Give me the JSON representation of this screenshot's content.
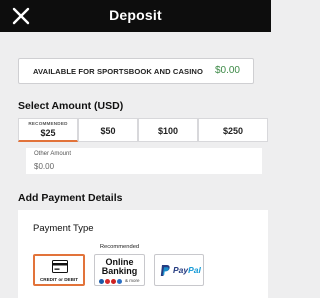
{
  "header": {
    "title": "Deposit",
    "close_icon": "close-icon"
  },
  "balance": {
    "label": "AVAILABLE FOR SPORTSBOOK AND CASINO",
    "value": "$0.00",
    "value_color": "#3d8a47"
  },
  "select_amount": {
    "title": "Select Amount (USD)",
    "recommended_badge": "RECOMMENDED",
    "options": [
      "$25",
      "$50",
      "$100",
      "$250"
    ],
    "selected": "$25"
  },
  "other_amount": {
    "label": "Other Amount",
    "value": "$0.00"
  },
  "payment_details": {
    "title": "Add Payment Details",
    "payment_type_label": "Payment Type",
    "recommended_label": "Recommended",
    "options": {
      "card": "CREDIT or DEBIT",
      "online_line1": "Online",
      "online_line2": "Banking",
      "online_more": "& more",
      "paypal_pay": "Pay",
      "paypal_pal": "Pal"
    }
  },
  "accent_color": "#e2733a"
}
